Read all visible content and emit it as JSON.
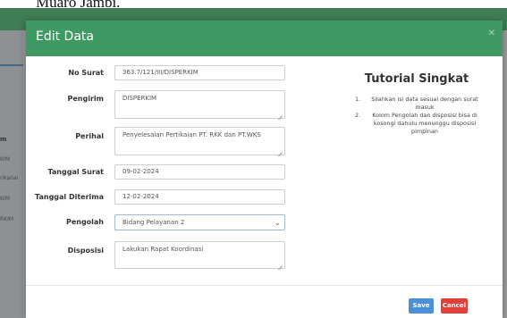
{
  "background": {
    "heading_fragment": "Muaro Jambi.",
    "sidebar_items": [
      "m",
      "KIM",
      "rikanai",
      "KIM",
      "RKIM"
    ]
  },
  "modal": {
    "title": "Edit Data",
    "close_icon": "close-icon",
    "fields": {
      "no_surat": {
        "label": "No Surat",
        "value": "363.7/121/III/DISPERKIM"
      },
      "pengirim": {
        "label": "Pengirim",
        "value": "DISPERKIM"
      },
      "perihal": {
        "label": "Perihal",
        "value": "Penyelesaian Pertikaian PT. RKK dan PT.WKS"
      },
      "tanggal_surat": {
        "label": "Tanggal Surat",
        "value": "09-02-2024"
      },
      "tanggal_diterima": {
        "label": "Tanggal Diterima",
        "value": "12-02-2024"
      },
      "pengolah": {
        "label": "Pengolah",
        "value": "Bidang Pelayanan 2"
      },
      "disposisi": {
        "label": "Disposisi",
        "value": "Lakukan Rapat Koordinasi"
      }
    },
    "tutorial": {
      "title": "Tutorial Singkat",
      "items": [
        {
          "num": "1.",
          "text": "Silahkan isi data sesuai dengan surat masuk"
        },
        {
          "num": "2.",
          "text": "Kolom Pengolah dan disposisi bisa di kosongi dahulu menunggu disposisi pimpinan"
        }
      ]
    },
    "buttons": {
      "save": "Save",
      "cancel": "Cancel"
    }
  },
  "colors": {
    "header_green": "#3e9a62",
    "topbar_green": "#3f7d54",
    "save_blue": "#4a90d9",
    "cancel_red": "#e0403a"
  }
}
